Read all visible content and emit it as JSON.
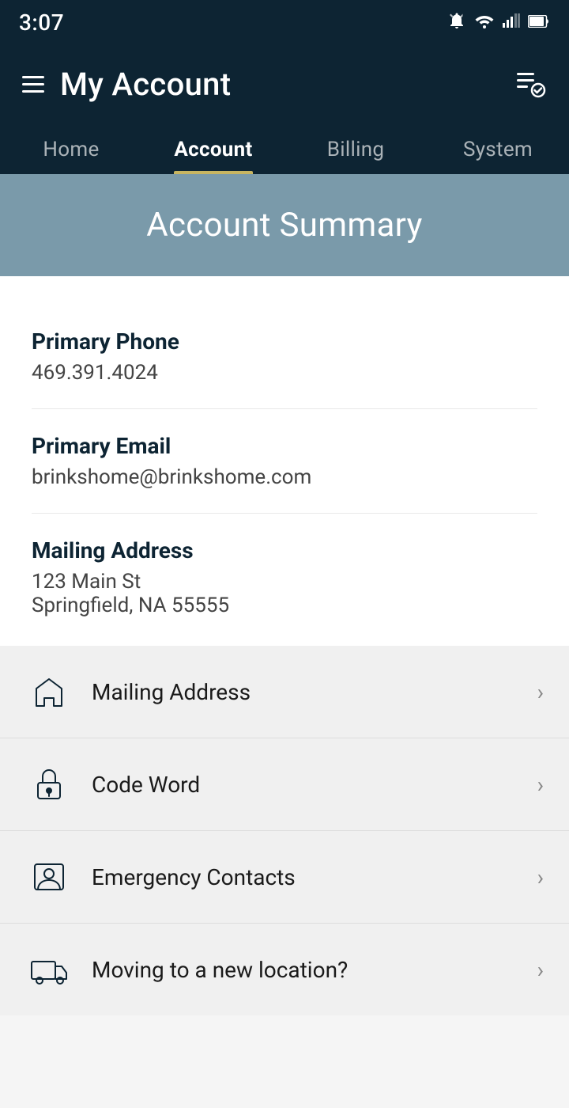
{
  "statusBar": {
    "time": "3:07",
    "icons": [
      "alarm",
      "wifi",
      "signal",
      "battery"
    ]
  },
  "header": {
    "title": "My Account",
    "menuIcon": "hamburger-menu",
    "actionIcon": "list-check"
  },
  "tabs": [
    {
      "label": "Home",
      "active": false
    },
    {
      "label": "Account",
      "active": true
    },
    {
      "label": "Billing",
      "active": false
    },
    {
      "label": "System",
      "active": false
    }
  ],
  "banner": {
    "title": "Account Summary"
  },
  "accountInfo": {
    "fields": [
      {
        "label": "Primary Phone",
        "value": "469.391.4024"
      },
      {
        "label": "Primary Email",
        "value": "brinkshome@brinkshome.com"
      },
      {
        "label": "Mailing Address",
        "value": "123 Main St\nSpringfield, NA 55555"
      }
    ]
  },
  "menuItems": [
    {
      "icon": "home",
      "label": "Mailing Address"
    },
    {
      "icon": "lock",
      "label": "Code Word"
    },
    {
      "icon": "contacts",
      "label": "Emergency Contacts"
    },
    {
      "icon": "truck",
      "label": "Moving to a new location?"
    }
  ]
}
